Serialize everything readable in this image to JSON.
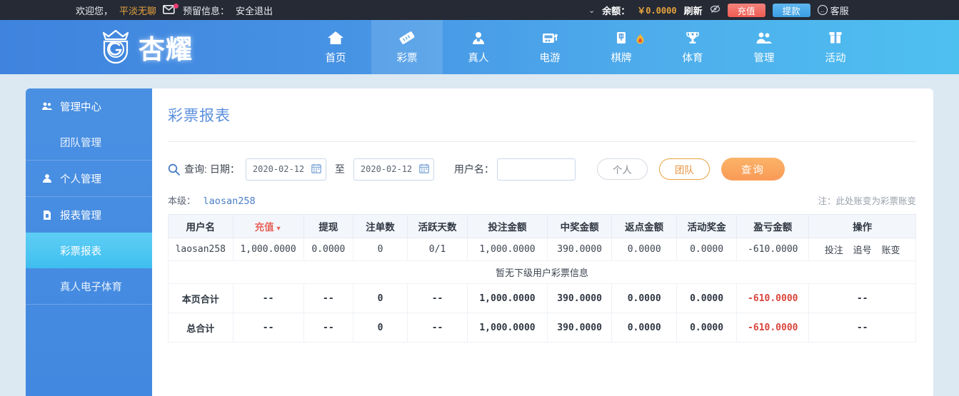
{
  "topbar": {
    "welcome": "欢迎您，",
    "username": "平淡无聊",
    "mail_icon": "mail-icon",
    "reserved_info": "预留信息：",
    "logout": "安全退出",
    "chevron": "⌄",
    "balance_label": "余额：",
    "balance_value": "￥0.0000",
    "refresh": "刷新",
    "eye_icon": "eye-off-icon",
    "recharge": "充值",
    "withdraw": "提款",
    "service": "客服",
    "service_icon": "chat-icon",
    "recharge_color": "#ee5b52",
    "withdraw_color": "#3a9fe5",
    "accent_color": "#e8a33d"
  },
  "brand": {
    "logo_text": "杏耀",
    "logo_icon": "crown-emblem-icon"
  },
  "nav": {
    "items": [
      {
        "label": "首页",
        "icon": "home-icon",
        "active": false,
        "badge": ""
      },
      {
        "label": "彩票",
        "icon": "ticket-icon",
        "active": true,
        "badge": ""
      },
      {
        "label": "真人",
        "icon": "dealer-icon",
        "active": false,
        "badge": ""
      },
      {
        "label": "电游",
        "icon": "slot-machine-icon",
        "active": false,
        "badge": ""
      },
      {
        "label": "棋牌",
        "icon": "mahjong-tile-icon",
        "active": false,
        "badge": "hot-fire-icon"
      },
      {
        "label": "体育",
        "icon": "trophy-icon",
        "active": false,
        "badge": ""
      },
      {
        "label": "管理",
        "icon": "users-icon",
        "active": false,
        "badge": ""
      },
      {
        "label": "活动",
        "icon": "gift-icon",
        "active": false,
        "badge": ""
      }
    ]
  },
  "sidebar": {
    "groups": [
      {
        "label": "管理中心",
        "icon": "users-icon",
        "children": [
          {
            "label": "团队管理",
            "active": false
          }
        ]
      },
      {
        "label": "个人管理",
        "icon": "user-icon",
        "children": []
      },
      {
        "label": "报表管理",
        "icon": "report-doc-icon",
        "children": [
          {
            "label": "彩票报表",
            "active": true
          },
          {
            "label": "真人电子体育",
            "active": false
          }
        ]
      }
    ]
  },
  "main": {
    "title": "彩票报表",
    "filter": {
      "search_icon": "search-icon",
      "query_label": "查询:",
      "date_label": "日期：",
      "date_from": "2020-02-12",
      "date_to": "2020-02-12",
      "to_label": "至",
      "calendar_icon": "calendar-icon",
      "username_label": "用户名：",
      "username_value": "",
      "username_placeholder": "",
      "btn_person": "个人",
      "btn_team": "团队",
      "btn_query": "查询"
    },
    "level_label": "本级：",
    "level_name": "laosan258",
    "note": "注：此处账变为彩票账变",
    "empty_text": "暂无下级用户彩票信息",
    "table": {
      "columns": [
        {
          "label": "用户名",
          "sorted": false
        },
        {
          "label": "充值",
          "sorted": true,
          "caret": "▼"
        },
        {
          "label": "提现",
          "sorted": false
        },
        {
          "label": "注单数",
          "sorted": false
        },
        {
          "label": "活跃天数",
          "sorted": false
        },
        {
          "label": "投注金额",
          "sorted": false
        },
        {
          "label": "中奖金额",
          "sorted": false
        },
        {
          "label": "返点金额",
          "sorted": false
        },
        {
          "label": "活动奖金",
          "sorted": false
        },
        {
          "label": "盈亏金额",
          "sorted": false
        },
        {
          "label": "操作",
          "sorted": false
        }
      ],
      "rows": [
        {
          "username": "laosan258",
          "recharge": "1,000.0000",
          "withdraw": "0.0000",
          "bet_count": "0",
          "active_days": "0/1",
          "bet_amount": "1,000.0000",
          "win_amount": "390.0000",
          "rebate": "0.0000",
          "bonus": "0.0000",
          "profit": "-610.0000",
          "ops": [
            "投注",
            "追号",
            "账变"
          ]
        }
      ],
      "summaries": [
        {
          "label": "本页合计",
          "recharge": "--",
          "withdraw": "--",
          "bet_count": "0",
          "active_days": "--",
          "bet_amount": "1,000.0000",
          "win_amount": "390.0000",
          "rebate": "0.0000",
          "bonus": "0.0000",
          "profit": "-610.0000",
          "ops": "--"
        },
        {
          "label": "总合计",
          "recharge": "--",
          "withdraw": "--",
          "bet_count": "0",
          "active_days": "--",
          "bet_amount": "1,000.0000",
          "win_amount": "390.0000",
          "rebate": "0.0000",
          "bonus": "0.0000",
          "profit": "-610.0000",
          "ops": "--"
        }
      ]
    }
  }
}
